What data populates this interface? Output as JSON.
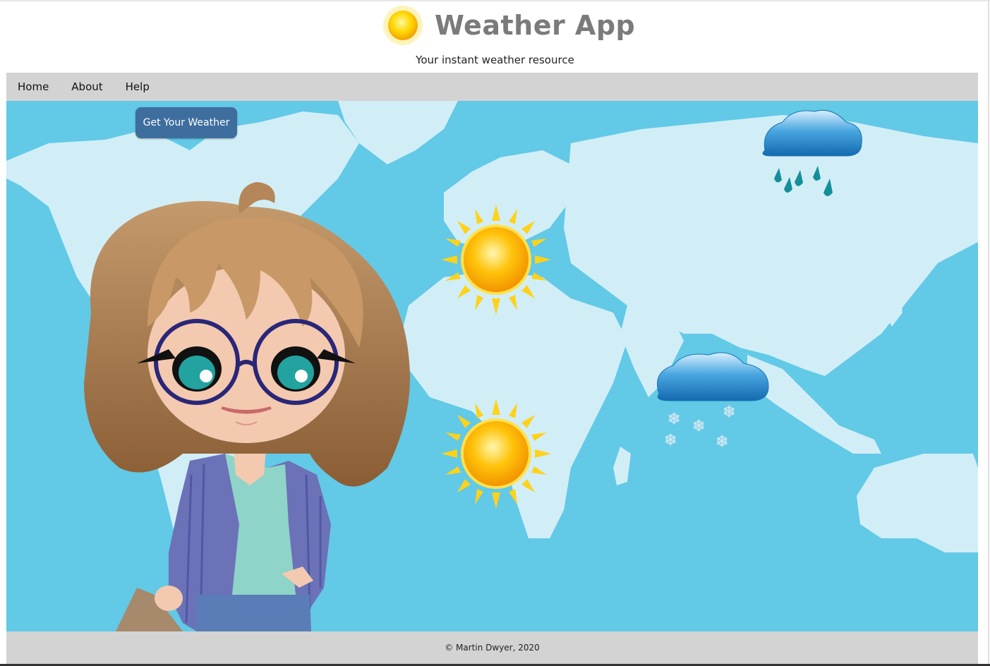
{
  "header": {
    "title": "Weather App",
    "subtitle": "Your instant weather resource",
    "logo_icon": "sun-icon"
  },
  "nav": {
    "items": [
      {
        "label": "Home"
      },
      {
        "label": "About"
      },
      {
        "label": "Help"
      }
    ]
  },
  "main": {
    "button_label": "Get Your Weather",
    "background_color": "#62c9e6",
    "land_color": "#d1eef7",
    "illustration": "cartoon-girl-with-glasses",
    "weather_icons": [
      "rain-cloud-icon",
      "sun-icon",
      "sun-icon",
      "snow-cloud-icon"
    ]
  },
  "footer": {
    "text": "© Martin Dwyer, 2020"
  },
  "colors": {
    "nav_bg": "#d3d3d3",
    "button_bg": "#3e6e9e",
    "title": "#7b7b7b"
  }
}
